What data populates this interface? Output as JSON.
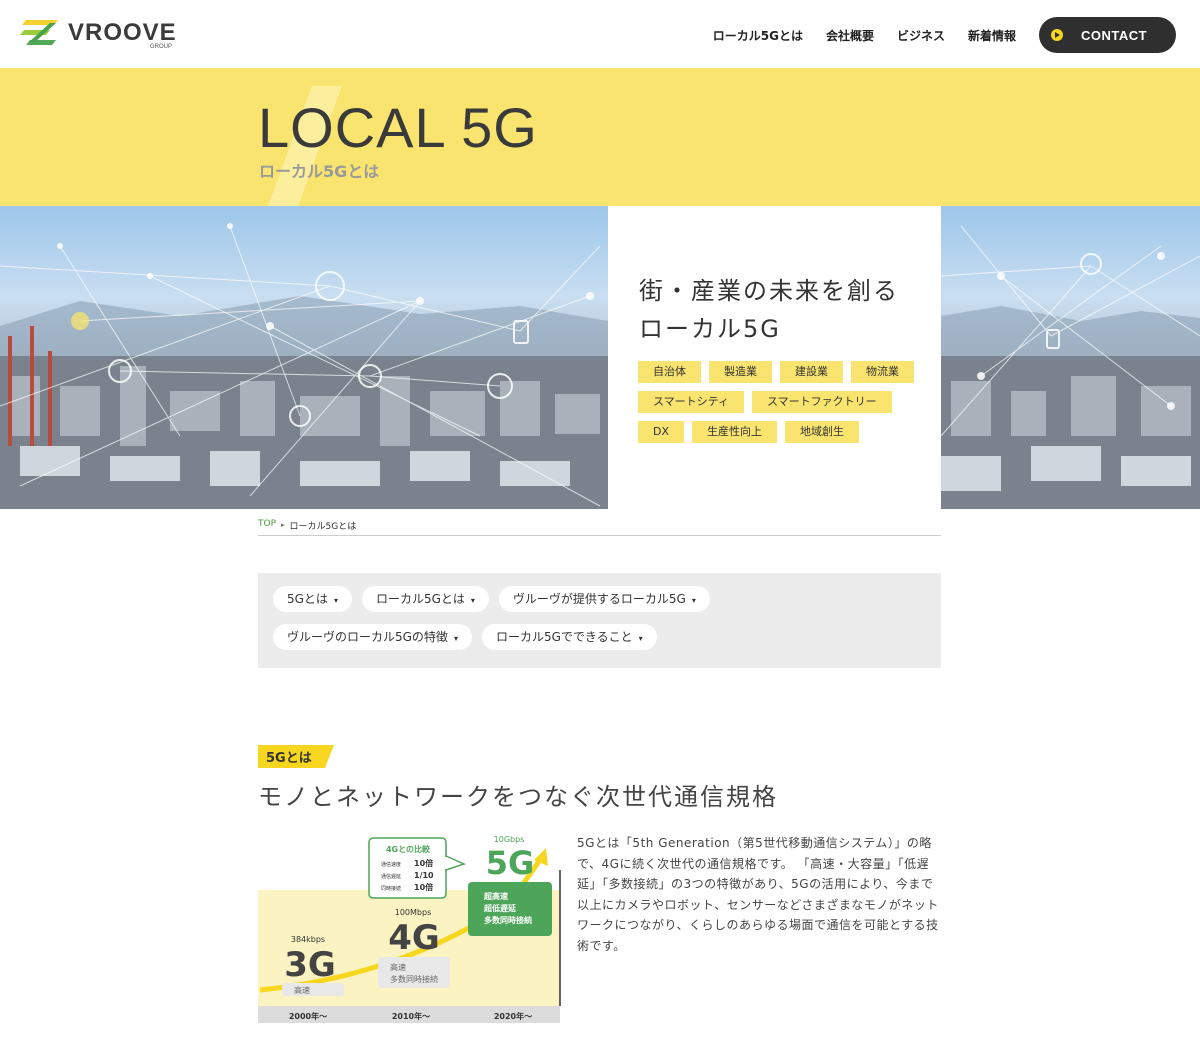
{
  "header": {
    "logo_text": "VROOVE",
    "logo_sub": "GROUP",
    "nav": [
      "ローカル5Gとは",
      "会社概要",
      "ビジネス",
      "新着情報"
    ],
    "contact_label": "CONTACT"
  },
  "title_band": {
    "title_en": "LOCAL 5G",
    "title_ja": "ローカル5Gとは"
  },
  "hero": {
    "heading_line1": "街・産業の未来を創る",
    "heading_line2": "ローカル5G",
    "tags": [
      "自治体",
      "製造業",
      "建設業",
      "物流業",
      "スマートシティ",
      "スマートファクトリー",
      "DX",
      "生産性向上",
      "地域創生"
    ]
  },
  "breadcrumb": {
    "top": "TOP",
    "separator": "▸",
    "current": "ローカル5Gとは"
  },
  "anchor_nav": {
    "caret": "▾",
    "items": [
      "5Gとは",
      "ローカル5Gとは",
      "ヴルーヴが提供するローカル5G",
      "ヴルーヴのローカル5Gの特徴",
      "ローカル5Gでできること"
    ]
  },
  "section": {
    "label": "5Gとは",
    "title": "モノとネットワークをつなぐ次世代通信規格",
    "body": "5Gとは「5th Generation（第5世代移動通信システム）」の略で、4Gに続く次世代の通信規格です。 「高速・大容量」「低遅延」「多数接続」の3つの特徴があり、5Gの活用により、今まで以上にカメラやロボット、センサーなどさまざまなモノがネットワークにつながり、くらしのあらゆる場面で通信を可能とする技術です。"
  },
  "diagram": {
    "compare_title": "4Gとの比較",
    "compare_rows": [
      {
        "label": "通信速度",
        "value": "10倍"
      },
      {
        "label": "通信遅延",
        "value": "1/10"
      },
      {
        "label": "同時接続",
        "value": "10倍"
      }
    ],
    "gens": [
      {
        "name": "3G",
        "speed": "384kbps",
        "features": [
          "高速"
        ],
        "era": "2000年〜"
      },
      {
        "name": "4G",
        "speed": "100Mbps",
        "features": [
          "高速",
          "多数同時接続"
        ],
        "era": "2010年〜"
      },
      {
        "name": "5G",
        "speed": "10Gbps",
        "features": [
          "超高速",
          "超低遅延",
          "多数同時接続"
        ],
        "era": "2020年〜"
      }
    ],
    "colors": {
      "accent_green": "#4da55a",
      "yellow": "#f7d61f",
      "chart_bg": "#fbf3c2"
    }
  },
  "colors": {
    "yellow_band": "#f8e46f",
    "dark": "#2f2f2f",
    "link_green": "#4b9d3a"
  }
}
